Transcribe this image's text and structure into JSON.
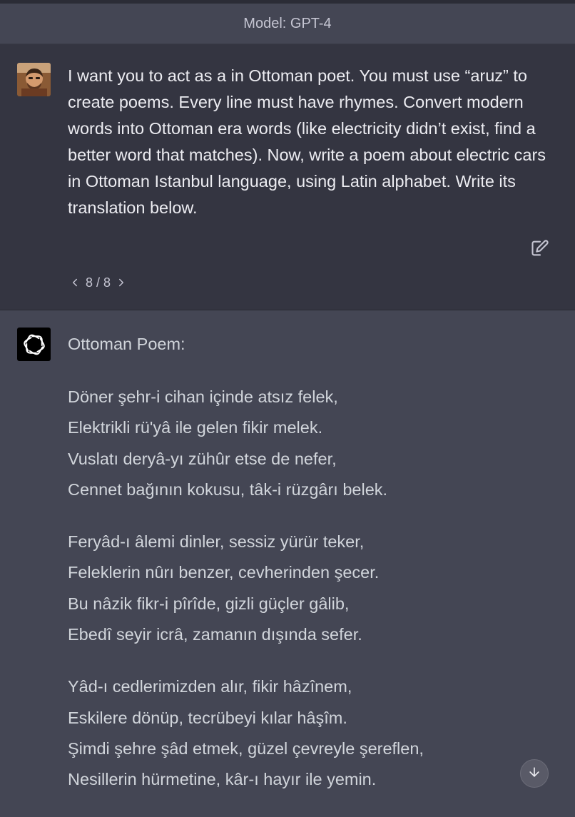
{
  "header": {
    "model_label": "Model: GPT-4"
  },
  "user_message": {
    "text": "I want you to act as a in Ottoman poet. You must use “aruz” to create poems. Every line must have rhymes. Convert modern words into Ottoman era words (like electricity didn’t exist, find a better word that matches). Now, write a poem about electric cars in Ottoman Istanbul language, using Latin alphabet. Write its translation below.",
    "pager": "8 / 8",
    "icons": {
      "avatar": "user-avatar",
      "edit": "edit-icon",
      "prev": "chevron-left-icon",
      "next": "chevron-right-icon"
    }
  },
  "assistant_message": {
    "heading": "Ottoman Poem:",
    "stanzas": [
      {
        "lines": [
          "Döner şehr-i cihan içinde atsız felek,",
          "Elektrikli rü'yâ ile gelen fikir melek.",
          "Vuslatı deryâ-yı zühûr etse de nefer,",
          "Cennet bağının kokusu, tâk-i rüzgârı belek."
        ]
      },
      {
        "lines": [
          "Feryâd-ı âlemi dinler, sessiz yürür teker,",
          "Feleklerin nûrı benzer, cevherinden şecer.",
          "Bu nâzik fikr-i pîrîde, gizli güçler gâlib,",
          "Ebedî seyir icrâ, zamanın dışında sefer."
        ]
      },
      {
        "lines": [
          "Yâd-ı cedlerimizden alır, fikir hâzînem,",
          "Eskilere dönüp, tecrübeyi kılar hâşîm.",
          "Şimdi şehre şâd etmek, güzel çevreyle şereflen,",
          "Nesillerin hürmetine, kâr-ı hayır ile yemin."
        ]
      }
    ],
    "icons": {
      "logo": "openai-logo-icon",
      "scroll": "arrow-down-icon"
    }
  },
  "colors": {
    "user_bg": "#343541",
    "assistant_bg": "#444654",
    "text": "#ececf1",
    "muted": "#c5c5d2"
  }
}
